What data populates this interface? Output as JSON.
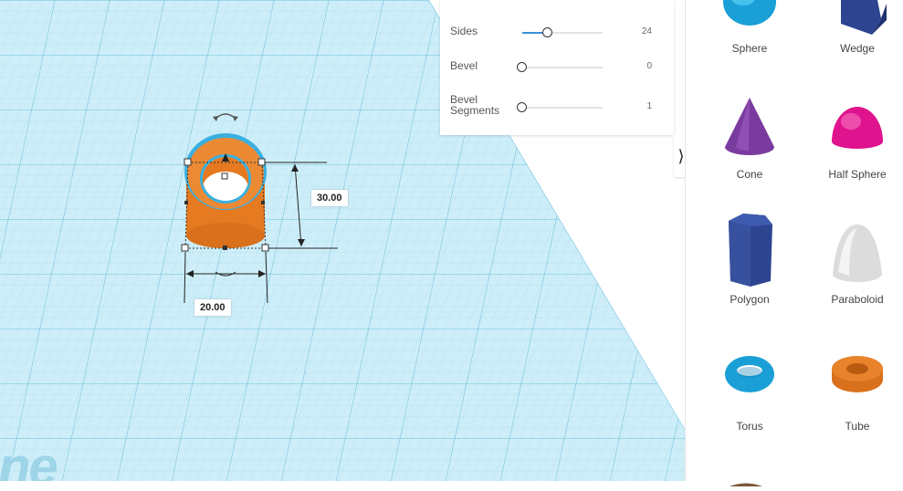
{
  "workplane": {
    "height_dimension": "30.00",
    "width_dimension": "20.00",
    "watermark": "ne"
  },
  "inspector": {
    "properties": [
      {
        "label": "Sides",
        "value": "24",
        "level": 0.3
      },
      {
        "label": "Bevel",
        "value": "0",
        "level": 0
      },
      {
        "label": "Bevel Segments",
        "value": "1",
        "level": 0
      }
    ]
  },
  "shapes": {
    "items": [
      {
        "label": "Sphere",
        "icon": "sphere-icon"
      },
      {
        "label": "Wedge",
        "icon": "wedge-icon"
      },
      {
        "label": "Cone",
        "icon": "cone-icon"
      },
      {
        "label": "Half Sphere",
        "icon": "half-sphere-icon"
      },
      {
        "label": "Polygon",
        "icon": "polygon-icon"
      },
      {
        "label": "Paraboloid",
        "icon": "paraboloid-icon"
      },
      {
        "label": "Torus",
        "icon": "torus-icon"
      },
      {
        "label": "Tube",
        "icon": "tube-icon"
      }
    ]
  },
  "colors": {
    "grid_background": "#c6ebf7",
    "grid_line": "#8ccde3",
    "selection_orange": "#e8832c",
    "accent_blue": "#3b8fd6"
  }
}
